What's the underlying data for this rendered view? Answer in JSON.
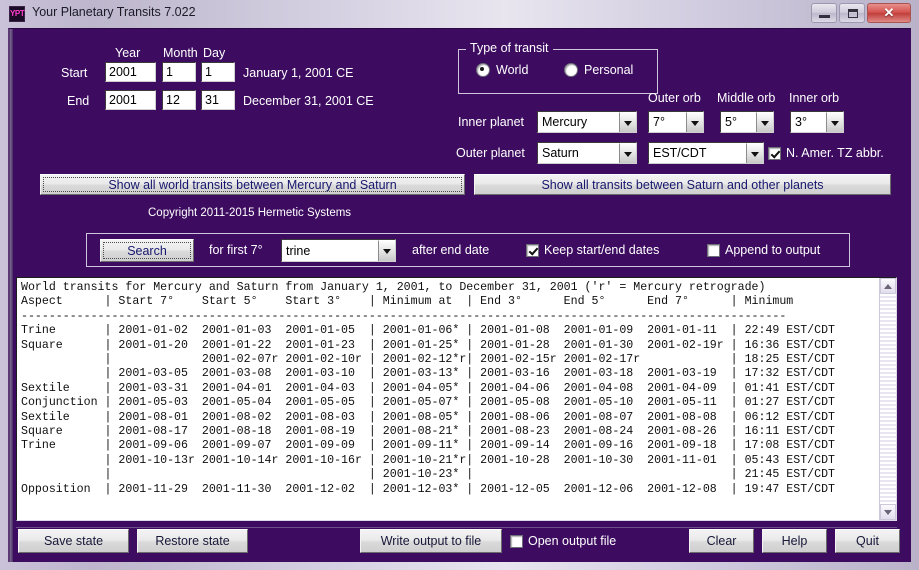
{
  "window": {
    "title": "Your Planetary Transits 7.022",
    "icon_label": "YPT",
    "minimize_label": "Minimize",
    "maximize_label": "Maximize",
    "close_label": "✕"
  },
  "dates": {
    "col_year": "Year",
    "col_month": "Month",
    "col_day": "Day",
    "start_label": "Start",
    "end_label": "End",
    "start_year": "2001",
    "start_month": "1",
    "start_day": "1",
    "start_text": "January 1, 2001 CE",
    "end_year": "2001",
    "end_month": "12",
    "end_day": "31",
    "end_text": "December 31, 2001 CE"
  },
  "transit_type": {
    "group_title": "Type of transit",
    "option_world": "World",
    "option_personal": "Personal",
    "selected": "World"
  },
  "planets": {
    "inner_label": "Inner planet",
    "inner_value": "Mercury",
    "outer_label": "Outer planet",
    "outer_value": "Saturn",
    "outer_orb_label": "Outer orb",
    "outer_orb_value": "7°",
    "middle_orb_label": "Middle orb",
    "middle_orb_value": "5°",
    "inner_orb_label": "Inner orb",
    "inner_orb_value": "3°",
    "timezone_value": "EST/CDT",
    "tz_abbr_label": "N. Amer. TZ abbr.",
    "tz_abbr_checked": true
  },
  "actions": {
    "show_world_transits": "Show all world transits between Mercury and Saturn",
    "show_other_planets": "Show all transits between Saturn and other planets"
  },
  "copyright": "Copyright 2011-2015 Hermetic Systems",
  "search": {
    "button": "Search",
    "for_first_label": "for first 7°",
    "aspect_value": "trine",
    "after_label": "after end date",
    "keep_dates_label": "Keep start/end dates",
    "keep_dates_checked": true,
    "append_label": "Append to output",
    "append_checked": false
  },
  "output": {
    "text": "World transits for Mercury and Saturn from January 1, 2001, to December 31, 2001 ('r' = Mercury retrograde)\nAspect      | Start 7°    Start 5°    Start 3°    | Minimum at  | End 3°      End 5°      End 7°      | Minimum\n--------------------------------------------------------------------------------------------------------------\nTrine       | 2001-01-02  2001-01-03  2001-01-05  | 2001-01-06* | 2001-01-08  2001-01-09  2001-01-11  | 22:49 EST/CDT\nSquare      | 2001-01-20  2001-01-22  2001-01-23  | 2001-01-25* | 2001-01-28  2001-01-30  2001-02-19r | 16:36 EST/CDT\n            |             2001-02-07r 2001-02-10r | 2001-02-12*r| 2001-02-15r 2001-02-17r             | 18:25 EST/CDT\n            | 2001-03-05  2001-03-08  2001-03-10  | 2001-03-13* | 2001-03-16  2001-03-18  2001-03-19  | 17:32 EST/CDT\nSextile     | 2001-03-31  2001-04-01  2001-04-03  | 2001-04-05* | 2001-04-06  2001-04-08  2001-04-09  | 01:41 EST/CDT\nConjunction | 2001-05-03  2001-05-04  2001-05-05  | 2001-05-07* | 2001-05-08  2001-05-10  2001-05-11  | 01:27 EST/CDT\nSextile     | 2001-08-01  2001-08-02  2001-08-03  | 2001-08-05* | 2001-08-06  2001-08-07  2001-08-08  | 06:12 EST/CDT\nSquare      | 2001-08-17  2001-08-18  2001-08-19  | 2001-08-21* | 2001-08-23  2001-08-24  2001-08-26  | 16:11 EST/CDT\nTrine       | 2001-09-06  2001-09-07  2001-09-09  | 2001-09-11* | 2001-09-14  2001-09-16  2001-09-18  | 17:08 EST/CDT\n            | 2001-10-13r 2001-10-14r 2001-10-16r | 2001-10-21*r| 2001-10-28  2001-10-30  2001-11-01  | 05:43 EST/CDT\n            |                                     | 2001-10-23* |                                     | 21:45 EST/CDT\nOpposition  | 2001-11-29  2001-11-30  2001-12-02  | 2001-12-03* | 2001-12-05  2001-12-06  2001-12-08  | 19:47 EST/CDT",
    "scroll_up": "▲",
    "scroll_down": "▼"
  },
  "footer": {
    "save_state": "Save state",
    "restore_state": "Restore state",
    "write_output": "Write output to file",
    "open_output_label": "Open output file",
    "open_output_checked": false,
    "clear": "Clear",
    "help": "Help",
    "quit": "Quit"
  }
}
